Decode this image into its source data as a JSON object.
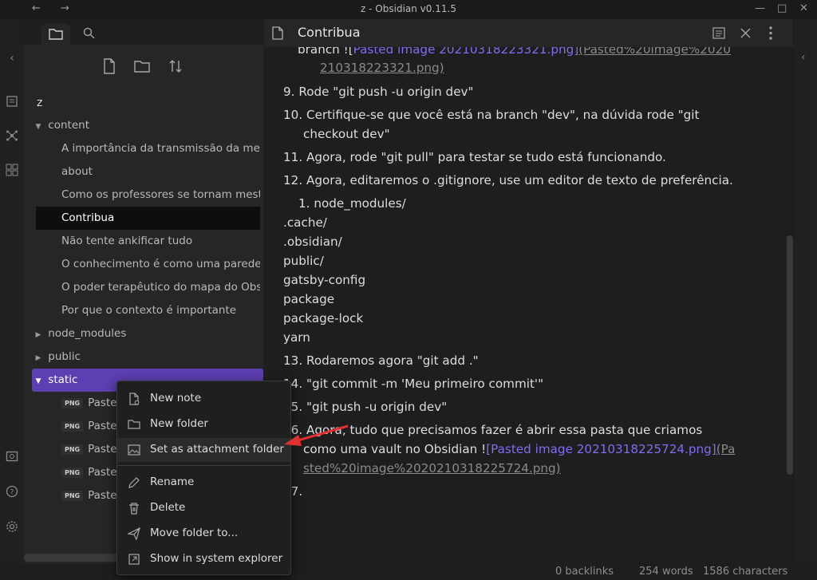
{
  "window": {
    "title": "z - Obsidian v0.11.5"
  },
  "sidebar": {
    "vault_name": "z",
    "tree": [
      {
        "kind": "folder",
        "label": "content",
        "expanded": true
      },
      {
        "kind": "file",
        "label": "A importância da transmissão da mens"
      },
      {
        "kind": "file",
        "label": "about"
      },
      {
        "kind": "file",
        "label": "Como os professores se tornam mestr"
      },
      {
        "kind": "file",
        "label": "Contribua",
        "active": true
      },
      {
        "kind": "file",
        "label": "Não tente ankificar tudo"
      },
      {
        "kind": "file",
        "label": "O conhecimento é como uma parede c"
      },
      {
        "kind": "file",
        "label": "O poder terapêutico do mapa do Obsi"
      },
      {
        "kind": "file",
        "label": "Por que o contexto é importante"
      },
      {
        "kind": "folder",
        "label": "node_modules",
        "expanded": false
      },
      {
        "kind": "folder",
        "label": "public",
        "expanded": false
      },
      {
        "kind": "folder",
        "label": "static",
        "expanded": true,
        "selected": true
      },
      {
        "kind": "image",
        "badge": "PNG",
        "label": "Paste"
      },
      {
        "kind": "image",
        "badge": "PNG",
        "label": "Paste"
      },
      {
        "kind": "image",
        "badge": "PNG",
        "label": "Paste"
      },
      {
        "kind": "image",
        "badge": "PNG",
        "label": "Paste"
      },
      {
        "kind": "image",
        "badge": "PNG",
        "label": "Paste"
      }
    ]
  },
  "editor": {
    "title": "Contribua",
    "lines": {
      "l0a": "branch  ![",
      "l0b": "Pasted image 20210318223321.png]",
      "l0c": "(Pasted%20image%2020",
      "l1": "210318223321.png)",
      "l2": "9. Rode \"git push -u origin dev\"",
      "l3": "10. Certifique-se que você está na branch \"dev\", na dúvida rode \"git",
      "l4": "checkout dev\"",
      "l5": "11. Agora, rode \"git pull\" para testar se tudo está funcionando.",
      "l6": "12. Agora, editaremos o .gitignore, use um editor de texto de preferência.",
      "l7": "1. node_modules/",
      "l8": ".cache/",
      "l9": ".obsidian/",
      "l10": "public/",
      "l11": "gatsby-config",
      "l12": "package",
      "l13": "package-lock",
      "l14": "yarn",
      "l15": "13. Rodaremos agora \"git add .\"",
      "l16": "14. \"git commit -m 'Meu primeiro commit'\"",
      "l17": "15. \"git push -u origin dev\"",
      "l18": "16. Agora, tudo que precisamos fazer é abrir essa pasta que criamos",
      "l19a": "como uma vault no Obsidian !",
      "l19b": "[Pasted image 20210318225724.png]",
      "l19c": "(Pa",
      "l20": "sted%20image%2020210318225724.png)",
      "l21": "17."
    }
  },
  "context_menu": {
    "items": [
      {
        "label": "New note",
        "icon": "new-note-icon"
      },
      {
        "label": "New folder",
        "icon": "new-folder-icon"
      },
      {
        "label": "Set as attachment folder",
        "icon": "image-icon",
        "hovered": true
      },
      {
        "label": "Rename",
        "icon": "pencil-icon"
      },
      {
        "label": "Delete",
        "icon": "trash-icon"
      },
      {
        "label": "Move folder to...",
        "icon": "send-icon"
      },
      {
        "label": "Show in system explorer",
        "icon": "external-link-icon"
      }
    ]
  },
  "status_bar": {
    "backlinks": "0 backlinks",
    "words": "254 words",
    "characters": "1586 characters"
  },
  "colors": {
    "accent": "#7f6df2",
    "selection": "#5c3fb0",
    "arrow": "#e03030"
  }
}
